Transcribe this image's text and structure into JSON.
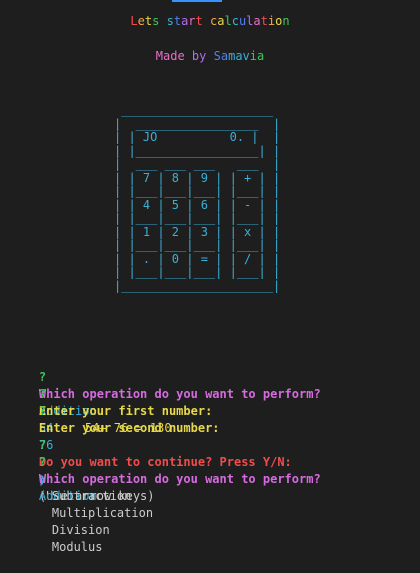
{
  "header": {
    "title_chars": [
      {
        "ch": "L",
        "c": "#f14c4c"
      },
      {
        "ch": "e",
        "c": "#f5a742"
      },
      {
        "ch": "t",
        "c": "#e7d94a"
      },
      {
        "ch": "s",
        "c": "#3fc55b"
      },
      {
        "ch": " ",
        "c": "#cccccc"
      },
      {
        "ch": "s",
        "c": "#3ab0d8"
      },
      {
        "ch": "t",
        "c": "#4f7ff0"
      },
      {
        "ch": "a",
        "c": "#b16ee8"
      },
      {
        "ch": "r",
        "c": "#e86ec8"
      },
      {
        "ch": "t",
        "c": "#f14c4c"
      },
      {
        "ch": " ",
        "c": "#cccccc"
      },
      {
        "ch": "c",
        "c": "#f5a742"
      },
      {
        "ch": "a",
        "c": "#e7d94a"
      },
      {
        "ch": "l",
        "c": "#3fc55b"
      },
      {
        "ch": "c",
        "c": "#3ab0d8"
      },
      {
        "ch": "u",
        "c": "#4f7ff0"
      },
      {
        "ch": "l",
        "c": "#b16ee8"
      },
      {
        "ch": "a",
        "c": "#e86ec8"
      },
      {
        "ch": "t",
        "c": "#f14c4c"
      },
      {
        "ch": "i",
        "c": "#f5a742"
      },
      {
        "ch": "o",
        "c": "#e7d94a"
      },
      {
        "ch": "n",
        "c": "#3fc55b"
      }
    ],
    "subtitle_chars": [
      {
        "ch": "M",
        "c": "#e86ec8"
      },
      {
        "ch": "a",
        "c": "#e86ec8"
      },
      {
        "ch": "d",
        "c": "#e86ec8"
      },
      {
        "ch": "e",
        "c": "#e86ec8"
      },
      {
        "ch": " ",
        "c": "#cccccc"
      },
      {
        "ch": "b",
        "c": "#b16ee8"
      },
      {
        "ch": "y",
        "c": "#b16ee8"
      },
      {
        "ch": " ",
        "c": "#cccccc"
      },
      {
        "ch": "S",
        "c": "#4f7ff0"
      },
      {
        "ch": "a",
        "c": "#4f7ff0"
      },
      {
        "ch": "m",
        "c": "#3ab0d8"
      },
      {
        "ch": "a",
        "c": "#3ab0d8"
      },
      {
        "ch": "v",
        "c": "#3ab0d8"
      },
      {
        "ch": "i",
        "c": "#3fc55b"
      },
      {
        "ch": "a",
        "c": "#3fc55b"
      }
    ]
  },
  "calculator_art": " _____________________\n|  _________________  |\n| | JO          0. |  |\n| |_________________| |\n|  ___ ___ ___   ___  |\n| | 7 | 8 | 9 | | + | |\n| |___|___|___| |___| |\n| | 4 | 5 | 6 | | - | |\n| |___|___|___| |___| |\n| | 1 | 2 | 3 | | x | |\n| |___|___|___| |___| |\n| | . | 0 | = | | / | |\n| |___|___|___| |___| |\n|_____________________|",
  "terminal": {
    "q_mark": "?",
    "q1_prompt": "Which operation do you want to perform?",
    "q1_answer": "Addition",
    "q2_prompt": "Enter your first number:",
    "q2_answer": "54",
    "q3_prompt": "Enter your second number:",
    "q3_answer": "76",
    "result": "54+ 76 = 130",
    "q4_prompt": "Do you want to continue? Press Y/N:",
    "q4_answer": "y",
    "q5_prompt": "Which operation do you want to perform?",
    "q5_hint": "(Use arrow keys)",
    "pointer": "❯",
    "menu_selected": "Addition",
    "menu_items": [
      "Subtraction",
      "Multiplication",
      "Division",
      "Modulus"
    ]
  }
}
